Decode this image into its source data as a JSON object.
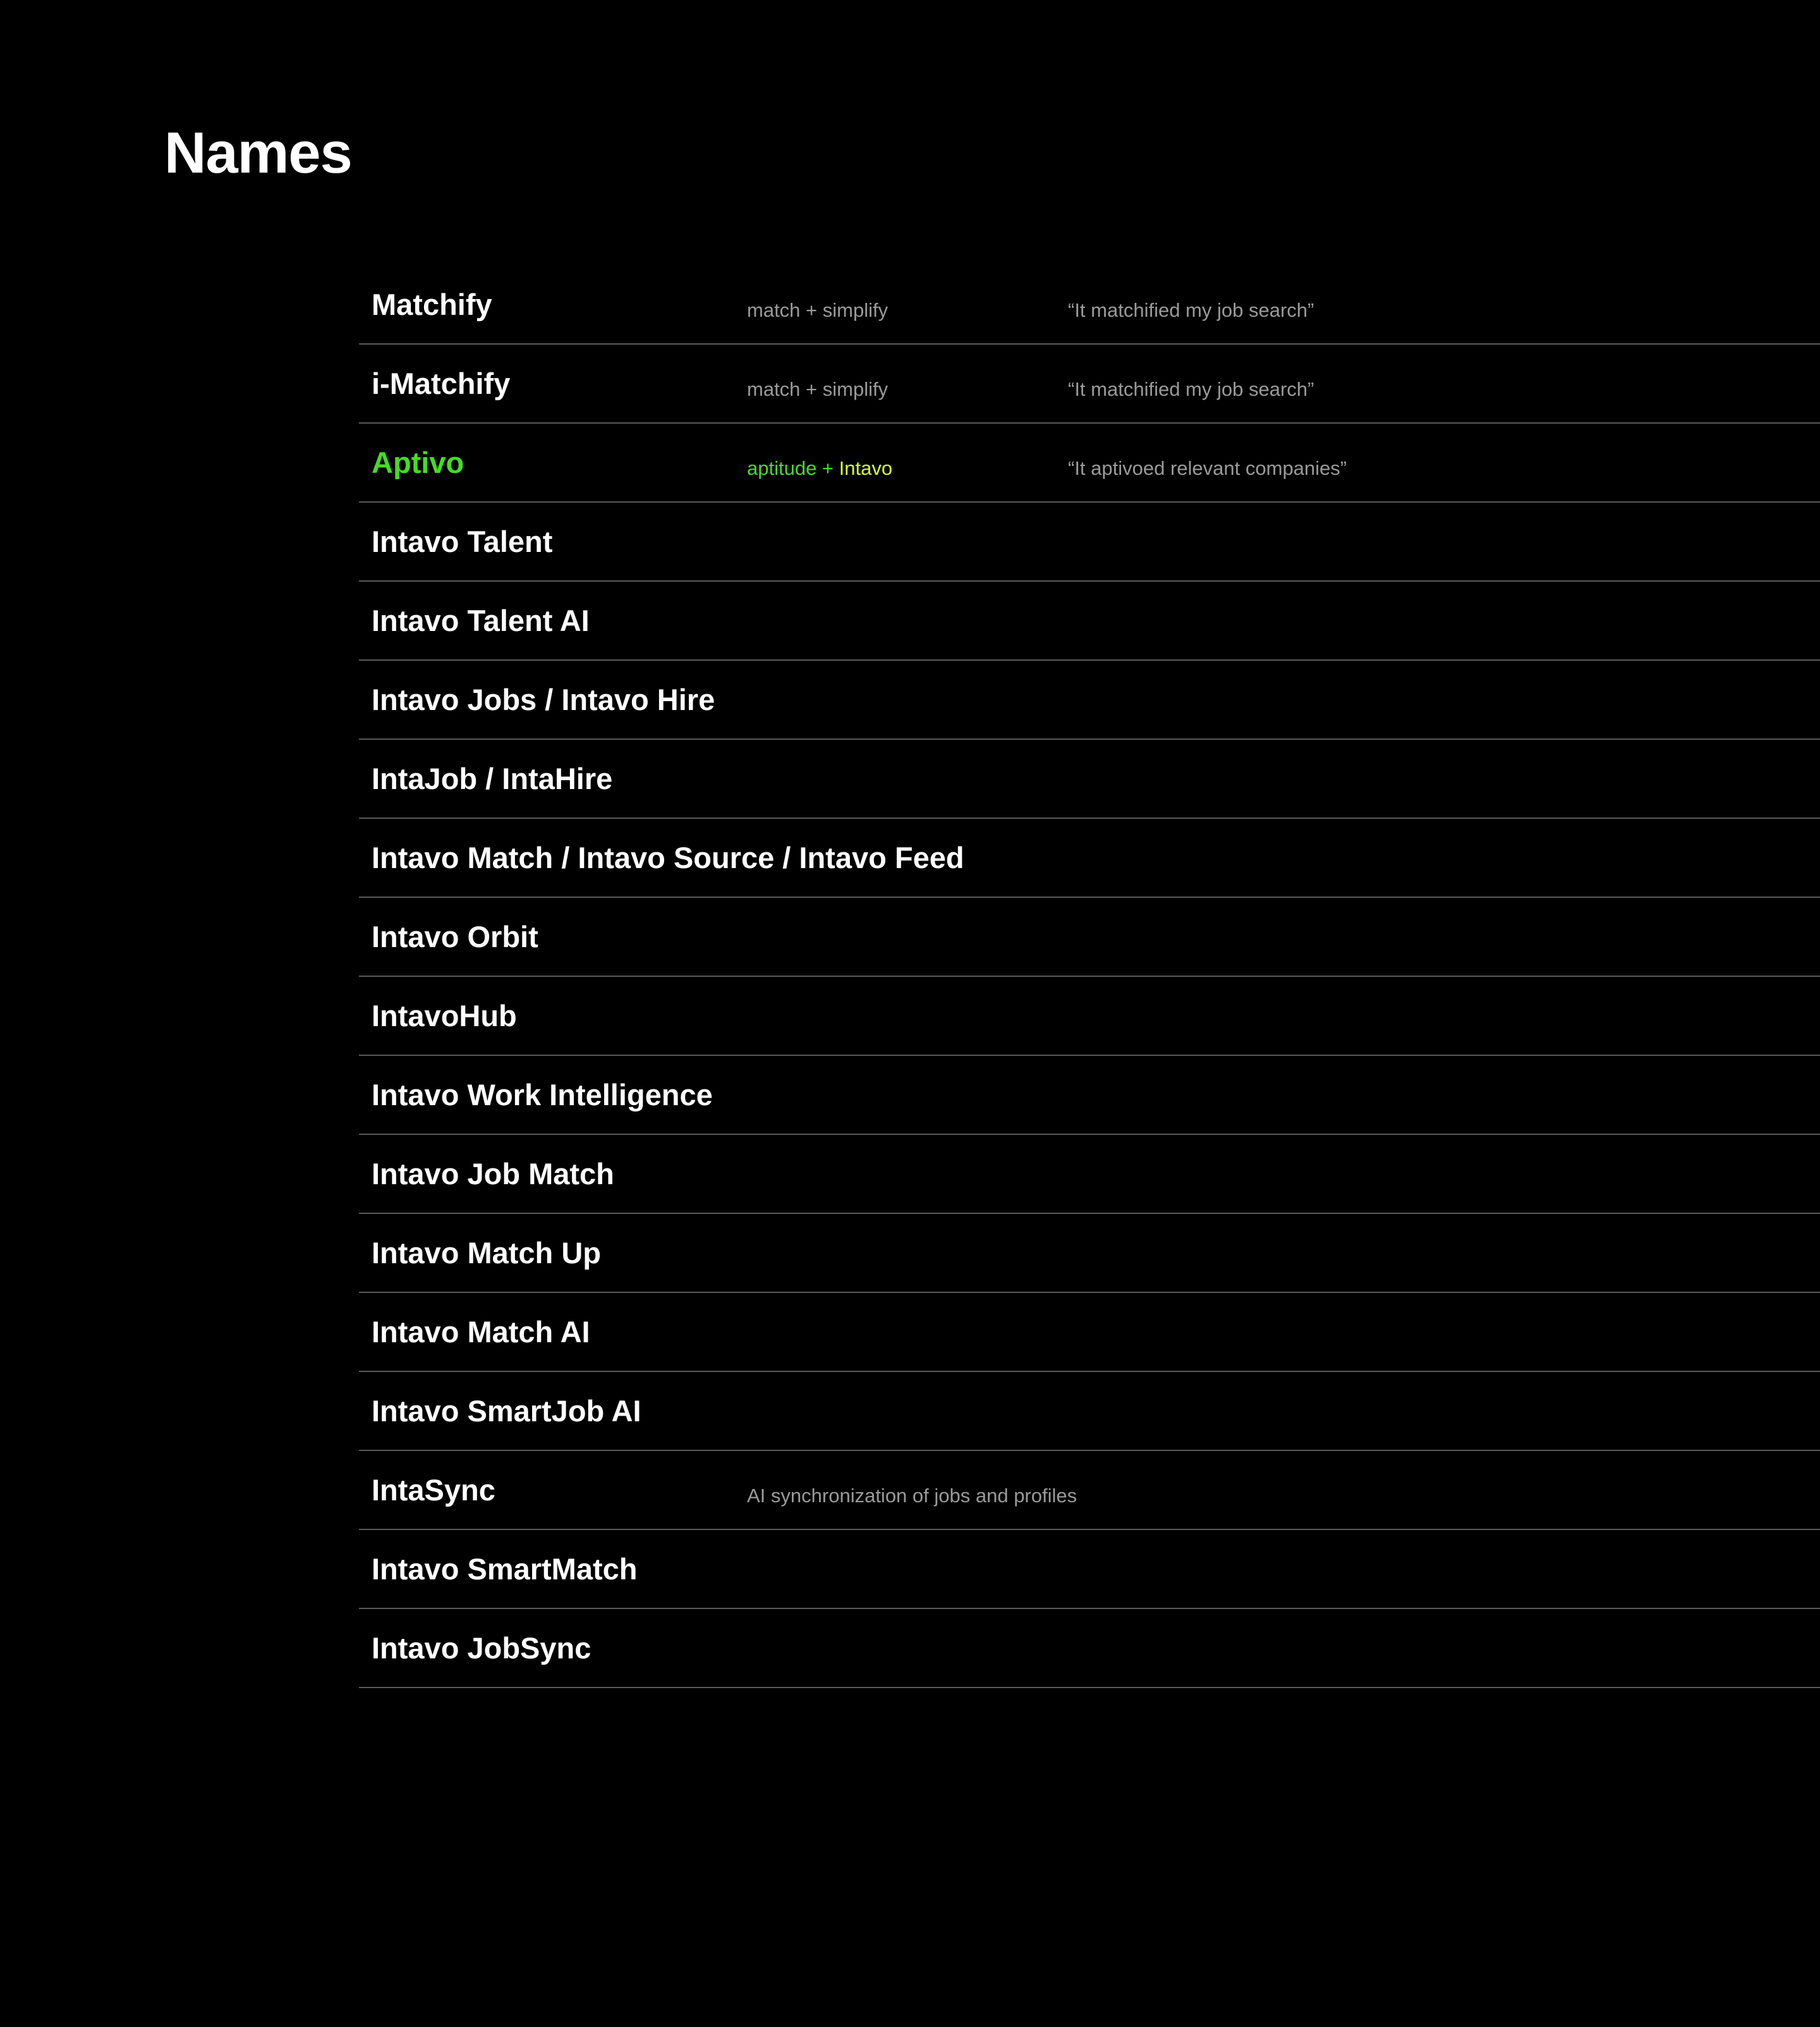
{
  "page": {
    "title": "Names"
  },
  "colors": {
    "background": "#000000",
    "text": "#ffffff",
    "muted": "#9a9a9a",
    "divider": "#5a5a5a",
    "highlight_green": "#44dd22",
    "highlight_yellow": "#d8ff2a"
  },
  "names": [
    {
      "title": "Matchify",
      "formula": "match + simplify",
      "quote": "“It matchified my job search”"
    },
    {
      "title": "i-Matchify",
      "formula": "match + simplify",
      "quote": "“It matchified my job search”"
    },
    {
      "title": "Aptivo",
      "formula_a": "aptitude + ",
      "formula_b": "Intavo",
      "quote": "“It aptivoed relevant companies”",
      "highlighted": true
    },
    {
      "title": "Intavo Talent"
    },
    {
      "title": "Intavo Talent AI"
    },
    {
      "title": "Intavo Jobs / Intavo Hire"
    },
    {
      "title": "IntaJob / IntaHire"
    },
    {
      "title": "Intavo Match / Intavo Source / Intavo Feed"
    },
    {
      "title": "Intavo Orbit"
    },
    {
      "title": "IntavoHub"
    },
    {
      "title": "Intavo Work Intelligence"
    },
    {
      "title": "Intavo Job Match"
    },
    {
      "title": "Intavo Match Up"
    },
    {
      "title": "Intavo Match AI"
    },
    {
      "title": "Intavo SmartJob AI"
    },
    {
      "title": "IntaSync",
      "formula": "AI synchronization of jobs and profiles"
    },
    {
      "title": "Intavo SmartMatch"
    },
    {
      "title": "Intavo JobSync"
    }
  ]
}
